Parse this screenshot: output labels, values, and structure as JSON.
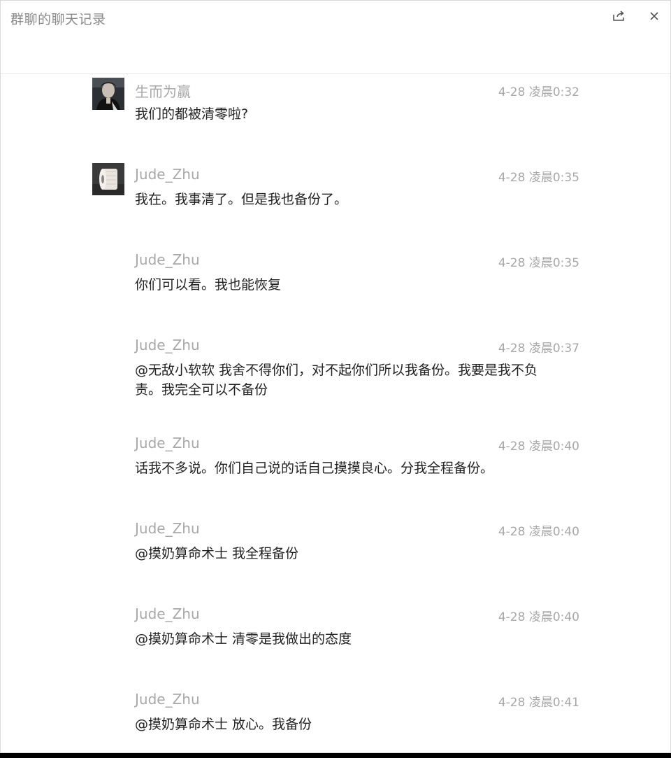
{
  "window": {
    "title": "群聊的聊天记录",
    "share_icon": "share-icon",
    "close_icon": "close-icon"
  },
  "messages": [
    {
      "sender": "生而为赢",
      "time": "4-28 凌晨0:32",
      "text": "我们的都被清零啦?",
      "avatar": "person-avatar"
    },
    {
      "sender": "Jude_Zhu",
      "time": "4-28 凌晨0:35",
      "text": "我在。我事清了。但是我也备份了。",
      "avatar": "tissue-roll-avatar"
    },
    {
      "sender": "Jude_Zhu",
      "time": "4-28 凌晨0:35",
      "text": "你们可以看。我也能恢复"
    },
    {
      "sender": "Jude_Zhu",
      "time": "4-28 凌晨0:37",
      "text": "@无敌小软软 我舍不得你们，对不起你们所以我备份。我要是我不负责。我完全可以不备份"
    },
    {
      "sender": "Jude_Zhu",
      "time": "4-28 凌晨0:40",
      "text": "话我不多说。你们自己说的话自己摸摸良心。分我全程备份。"
    },
    {
      "sender": "Jude_Zhu",
      "time": "4-28 凌晨0:40",
      "text": "@摸奶算命术士 我全程备份"
    },
    {
      "sender": "Jude_Zhu",
      "time": "4-28 凌晨0:40",
      "text": "@摸奶算命术士 清零是我做出的态度"
    },
    {
      "sender": "Jude_Zhu",
      "time": "4-28 凌晨0:41",
      "text": "@摸奶算命术士 放心。我备份"
    }
  ]
}
